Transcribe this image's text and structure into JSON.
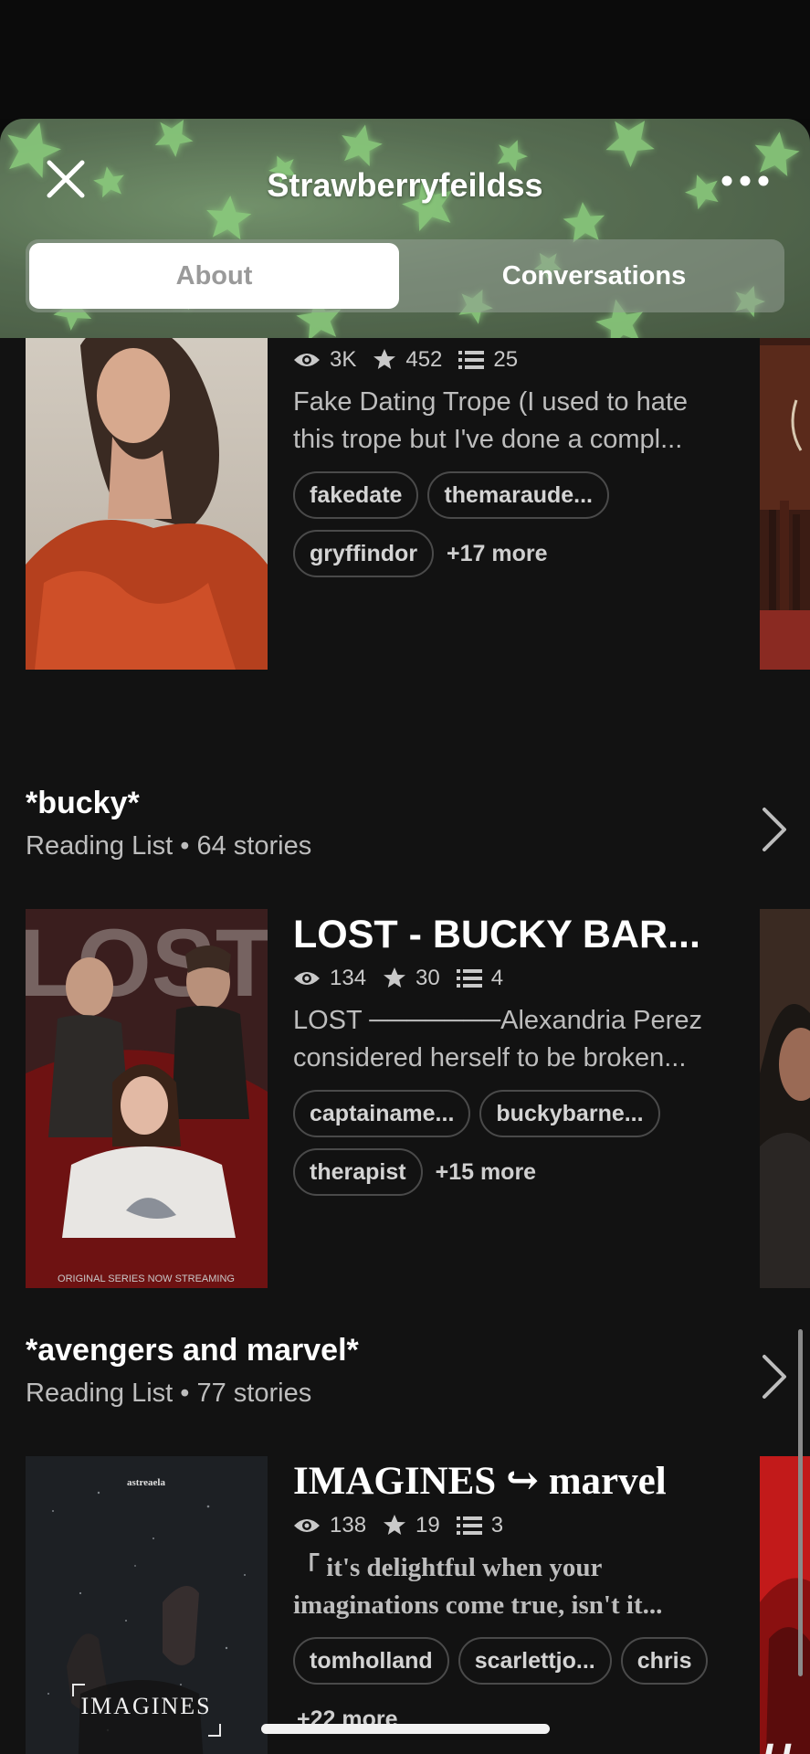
{
  "header": {
    "title": "Strawberryfeildss",
    "close_icon": "close-icon",
    "more_icon": "more-horizontal-icon",
    "background_color": "#55704f"
  },
  "tabs": [
    {
      "label": "About",
      "active": true
    },
    {
      "label": "Conversations",
      "active": false
    }
  ],
  "stories": [
    {
      "title": "",
      "reads": "3K",
      "votes": "452",
      "parts": "25",
      "description": "Fake Dating Trope (I used to hate this trope but I've done a compl...",
      "tags": [
        "fakedate",
        "themaraude...",
        "gryffindor"
      ],
      "more_tags": "+17 more"
    },
    {
      "title": "LOST - BUCKY BAR...",
      "reads": "134",
      "votes": "30",
      "parts": "4",
      "description": "LOST ───────Alexandria Perez considered herself to be broken...",
      "tags": [
        "captainame...",
        "buckybarne...",
        "therapist"
      ],
      "more_tags": "+15 more",
      "cover_text": "LOST",
      "cover_caption": "ORIGINAL SERIES NOW STREAMING"
    },
    {
      "title": "IMAGINES ↪ marvel",
      "reads": "138",
      "votes": "19",
      "parts": "3",
      "description": "「 it's delightful when your imaginations come true, isn't it...",
      "tags": [
        "tomholland",
        "scarlettjo...",
        "chris"
      ],
      "more_tags": "+22 more",
      "cover_text": "IMAGINES",
      "cover_author": "astreaela"
    }
  ],
  "reading_lists": [
    {
      "name": "*bucky*",
      "meta": "Reading List • 64 stories"
    },
    {
      "name": "*avengers and marvel*",
      "meta": "Reading List • 77 stories"
    }
  ],
  "icons": {
    "reads": "eye-icon",
    "votes": "star-icon",
    "parts": "list-icon",
    "list_arrow": "chevron-right-icon"
  }
}
